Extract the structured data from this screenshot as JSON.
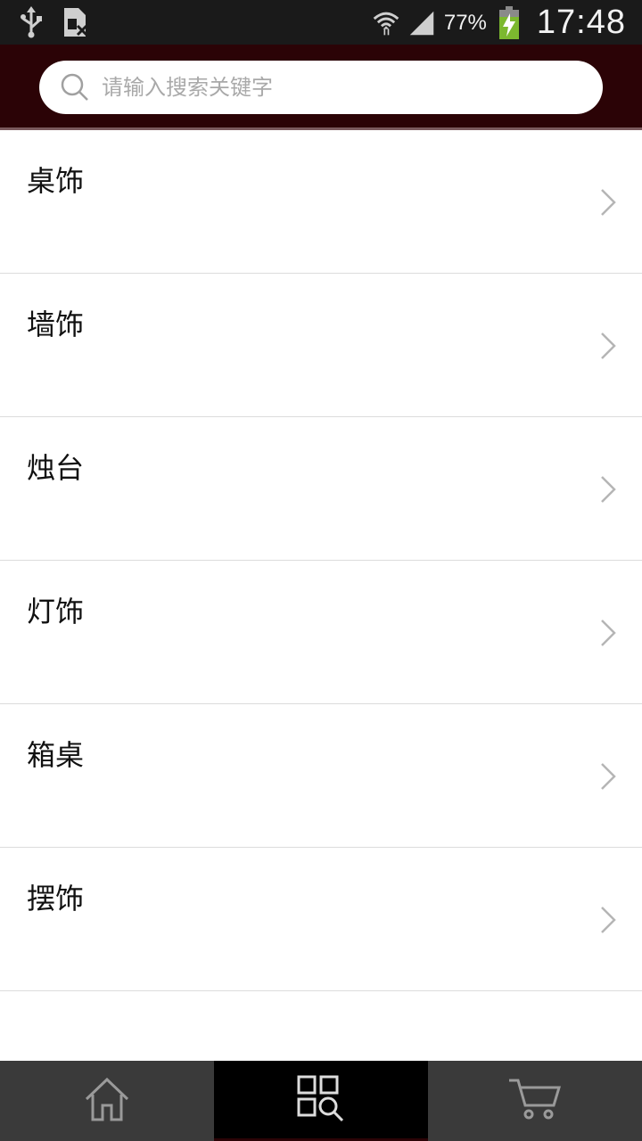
{
  "status_bar": {
    "battery_percent": "77%",
    "time": "17:48",
    "icons": [
      "usb-icon",
      "sim-card-icon",
      "wifi-icon",
      "signal-icon",
      "battery-charging-icon"
    ]
  },
  "search": {
    "placeholder": "请输入搜索关键字",
    "value": ""
  },
  "categories": [
    {
      "label": "桌饰"
    },
    {
      "label": "墙饰"
    },
    {
      "label": "烛台"
    },
    {
      "label": "灯饰"
    },
    {
      "label": "箱桌"
    },
    {
      "label": "摆饰"
    }
  ],
  "bottom_nav": {
    "tabs": [
      {
        "icon": "home-icon",
        "active": false
      },
      {
        "icon": "category-search-icon",
        "active": true
      },
      {
        "icon": "cart-icon",
        "active": false
      }
    ]
  },
  "colors": {
    "header_bg": "#2b0306",
    "nav_bg": "#3a3a3a",
    "nav_active_bg": "#000000"
  }
}
